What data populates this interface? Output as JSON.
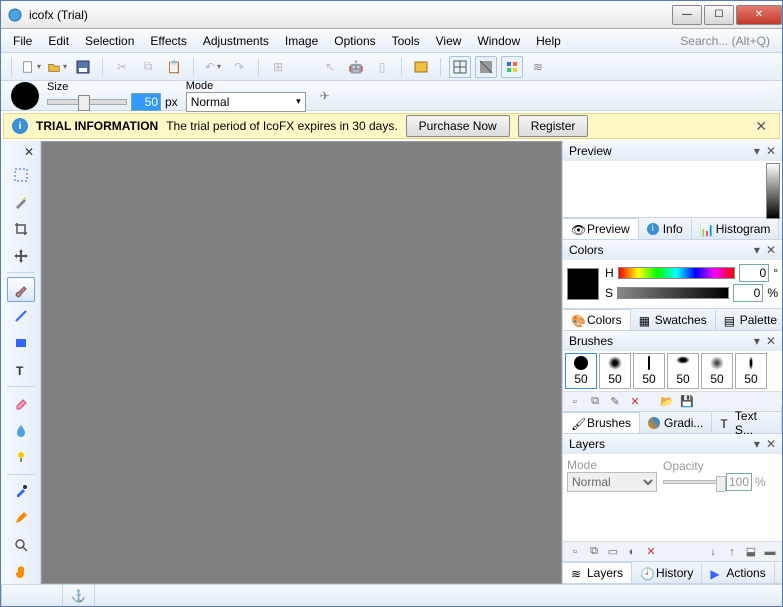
{
  "window": {
    "title": "icofx (Trial)"
  },
  "menu": [
    "File",
    "Edit",
    "Selection",
    "Effects",
    "Adjustments",
    "Image",
    "Options",
    "Tools",
    "View",
    "Window",
    "Help"
  ],
  "search_placeholder": "Search... (Alt+Q)",
  "options": {
    "size_label": "Size",
    "size_value": "50",
    "size_unit": "px",
    "mode_label": "Mode",
    "mode_value": "Normal"
  },
  "trial": {
    "title": "TRIAL INFORMATION",
    "message": "The trial period of IcoFX expires in 30 days.",
    "purchase": "Purchase Now",
    "register": "Register"
  },
  "panels": {
    "preview": {
      "title": "Preview",
      "tabs": [
        "Preview",
        "Info",
        "Histogram"
      ]
    },
    "colors": {
      "title": "Colors",
      "h_label": "H",
      "h_value": "0",
      "h_unit": "°",
      "s_label": "S",
      "s_value": "0",
      "s_unit": "%",
      "tabs": [
        "Colors",
        "Swatches",
        "Palette"
      ]
    },
    "brushes": {
      "title": "Brushes",
      "sizes": [
        "50",
        "50",
        "50",
        "50",
        "50",
        "50"
      ],
      "tabs": [
        "Brushes",
        "Gradi...",
        "Text S..."
      ]
    },
    "layers": {
      "title": "Layers",
      "mode_label": "Mode",
      "mode_value": "Normal",
      "opacity_label": "Opacity",
      "opacity_value": "100",
      "opacity_unit": "%",
      "tabs": [
        "Layers",
        "History",
        "Actions"
      ]
    }
  }
}
